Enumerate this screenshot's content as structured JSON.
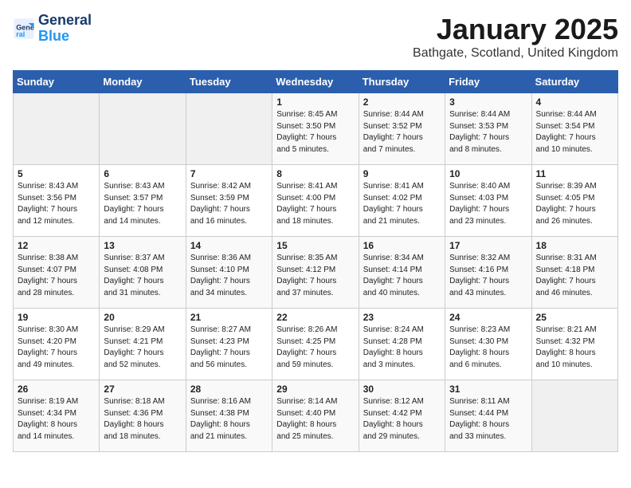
{
  "header": {
    "logo_line1": "General",
    "logo_line2": "Blue",
    "title": "January 2025",
    "subtitle": "Bathgate, Scotland, United Kingdom"
  },
  "weekdays": [
    "Sunday",
    "Monday",
    "Tuesday",
    "Wednesday",
    "Thursday",
    "Friday",
    "Saturday"
  ],
  "weeks": [
    [
      {
        "day": "",
        "info": ""
      },
      {
        "day": "",
        "info": ""
      },
      {
        "day": "",
        "info": ""
      },
      {
        "day": "1",
        "info": "Sunrise: 8:45 AM\nSunset: 3:50 PM\nDaylight: 7 hours\nand 5 minutes."
      },
      {
        "day": "2",
        "info": "Sunrise: 8:44 AM\nSunset: 3:52 PM\nDaylight: 7 hours\nand 7 minutes."
      },
      {
        "day": "3",
        "info": "Sunrise: 8:44 AM\nSunset: 3:53 PM\nDaylight: 7 hours\nand 8 minutes."
      },
      {
        "day": "4",
        "info": "Sunrise: 8:44 AM\nSunset: 3:54 PM\nDaylight: 7 hours\nand 10 minutes."
      }
    ],
    [
      {
        "day": "5",
        "info": "Sunrise: 8:43 AM\nSunset: 3:56 PM\nDaylight: 7 hours\nand 12 minutes."
      },
      {
        "day": "6",
        "info": "Sunrise: 8:43 AM\nSunset: 3:57 PM\nDaylight: 7 hours\nand 14 minutes."
      },
      {
        "day": "7",
        "info": "Sunrise: 8:42 AM\nSunset: 3:59 PM\nDaylight: 7 hours\nand 16 minutes."
      },
      {
        "day": "8",
        "info": "Sunrise: 8:41 AM\nSunset: 4:00 PM\nDaylight: 7 hours\nand 18 minutes."
      },
      {
        "day": "9",
        "info": "Sunrise: 8:41 AM\nSunset: 4:02 PM\nDaylight: 7 hours\nand 21 minutes."
      },
      {
        "day": "10",
        "info": "Sunrise: 8:40 AM\nSunset: 4:03 PM\nDaylight: 7 hours\nand 23 minutes."
      },
      {
        "day": "11",
        "info": "Sunrise: 8:39 AM\nSunset: 4:05 PM\nDaylight: 7 hours\nand 26 minutes."
      }
    ],
    [
      {
        "day": "12",
        "info": "Sunrise: 8:38 AM\nSunset: 4:07 PM\nDaylight: 7 hours\nand 28 minutes."
      },
      {
        "day": "13",
        "info": "Sunrise: 8:37 AM\nSunset: 4:08 PM\nDaylight: 7 hours\nand 31 minutes."
      },
      {
        "day": "14",
        "info": "Sunrise: 8:36 AM\nSunset: 4:10 PM\nDaylight: 7 hours\nand 34 minutes."
      },
      {
        "day": "15",
        "info": "Sunrise: 8:35 AM\nSunset: 4:12 PM\nDaylight: 7 hours\nand 37 minutes."
      },
      {
        "day": "16",
        "info": "Sunrise: 8:34 AM\nSunset: 4:14 PM\nDaylight: 7 hours\nand 40 minutes."
      },
      {
        "day": "17",
        "info": "Sunrise: 8:32 AM\nSunset: 4:16 PM\nDaylight: 7 hours\nand 43 minutes."
      },
      {
        "day": "18",
        "info": "Sunrise: 8:31 AM\nSunset: 4:18 PM\nDaylight: 7 hours\nand 46 minutes."
      }
    ],
    [
      {
        "day": "19",
        "info": "Sunrise: 8:30 AM\nSunset: 4:20 PM\nDaylight: 7 hours\nand 49 minutes."
      },
      {
        "day": "20",
        "info": "Sunrise: 8:29 AM\nSunset: 4:21 PM\nDaylight: 7 hours\nand 52 minutes."
      },
      {
        "day": "21",
        "info": "Sunrise: 8:27 AM\nSunset: 4:23 PM\nDaylight: 7 hours\nand 56 minutes."
      },
      {
        "day": "22",
        "info": "Sunrise: 8:26 AM\nSunset: 4:25 PM\nDaylight: 7 hours\nand 59 minutes."
      },
      {
        "day": "23",
        "info": "Sunrise: 8:24 AM\nSunset: 4:28 PM\nDaylight: 8 hours\nand 3 minutes."
      },
      {
        "day": "24",
        "info": "Sunrise: 8:23 AM\nSunset: 4:30 PM\nDaylight: 8 hours\nand 6 minutes."
      },
      {
        "day": "25",
        "info": "Sunrise: 8:21 AM\nSunset: 4:32 PM\nDaylight: 8 hours\nand 10 minutes."
      }
    ],
    [
      {
        "day": "26",
        "info": "Sunrise: 8:19 AM\nSunset: 4:34 PM\nDaylight: 8 hours\nand 14 minutes."
      },
      {
        "day": "27",
        "info": "Sunrise: 8:18 AM\nSunset: 4:36 PM\nDaylight: 8 hours\nand 18 minutes."
      },
      {
        "day": "28",
        "info": "Sunrise: 8:16 AM\nSunset: 4:38 PM\nDaylight: 8 hours\nand 21 minutes."
      },
      {
        "day": "29",
        "info": "Sunrise: 8:14 AM\nSunset: 4:40 PM\nDaylight: 8 hours\nand 25 minutes."
      },
      {
        "day": "30",
        "info": "Sunrise: 8:12 AM\nSunset: 4:42 PM\nDaylight: 8 hours\nand 29 minutes."
      },
      {
        "day": "31",
        "info": "Sunrise: 8:11 AM\nSunset: 4:44 PM\nDaylight: 8 hours\nand 33 minutes."
      },
      {
        "day": "",
        "info": ""
      }
    ]
  ]
}
